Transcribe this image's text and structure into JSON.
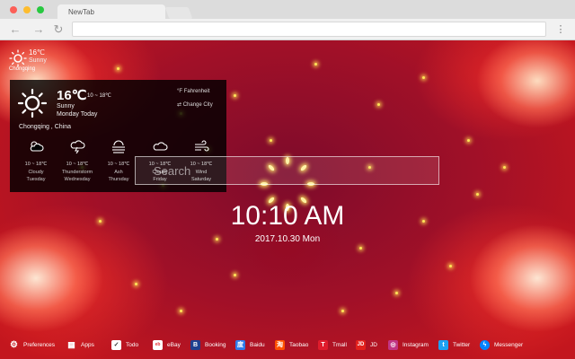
{
  "browser": {
    "tab_title": "NewTab",
    "back_icon": "back-arrow-icon",
    "forward_icon": "forward-arrow-icon",
    "reload_icon": "reload-icon",
    "menu_icon": "kebab-menu-icon"
  },
  "weather_widget": {
    "temp": "16℃",
    "condition": "Sunny",
    "city": "Chongqing"
  },
  "weather_panel": {
    "temp": "16℃",
    "range": "10 ~ 18℃",
    "condition": "Sunny",
    "day": "Monday Today",
    "city": "Chongqing , China",
    "fahrenheit_label": "°F Fahrenheit",
    "change_city_label": "⇄ Change City",
    "forecast": [
      {
        "icon": "cloudy-sun-icon",
        "range": "10 ~ 18℃",
        "condition": "Cloudy",
        "day": "Tuesday"
      },
      {
        "icon": "thunderstorm-icon",
        "range": "10 ~ 18℃",
        "condition": "Thunderstorm",
        "day": "Wednesday"
      },
      {
        "icon": "fog-icon",
        "range": "10 ~ 18℃",
        "condition": "Ash",
        "day": "Thursday"
      },
      {
        "icon": "cloud-icon",
        "range": "10 ~ 18℃",
        "condition": "Cloudy",
        "day": "Friday"
      },
      {
        "icon": "wind-icon",
        "range": "10 ~ 18℃",
        "condition": "Wind",
        "day": "Saturday"
      }
    ]
  },
  "search": {
    "placeholder": "Search"
  },
  "clock": {
    "time": "10:10 AM",
    "date": "2017.10.30 Mon"
  },
  "bottom_bar": {
    "items": [
      {
        "label": "Preferences",
        "icon": "gear-icon",
        "color": "#ffffff"
      },
      {
        "label": "Apps",
        "icon": "apps-grid-icon",
        "color": "#ffffff"
      },
      {
        "label": "Todo",
        "icon": "checkbox-icon",
        "color": "#ffffff"
      },
      {
        "label": "eBay",
        "icon": "ebay-icon",
        "color": "#ffffff"
      },
      {
        "label": "Booking",
        "icon": "booking-icon",
        "color": "#1f3f8f"
      },
      {
        "label": "Baidu",
        "icon": "baidu-icon",
        "color": "#2f7bea"
      },
      {
        "label": "Taobao",
        "icon": "taobao-icon",
        "color": "#ff5000"
      },
      {
        "label": "Tmall",
        "icon": "tmall-icon",
        "color": "#e01c2c"
      },
      {
        "label": "JD",
        "icon": "jd-icon",
        "color": "#e3211c"
      },
      {
        "label": "Instagram",
        "icon": "instagram-icon",
        "color": "#c13584"
      },
      {
        "label": "Twitter",
        "icon": "twitter-icon",
        "color": "#1da1f2"
      },
      {
        "label": "Messenger",
        "icon": "messenger-icon",
        "color": "#0084ff"
      }
    ]
  }
}
